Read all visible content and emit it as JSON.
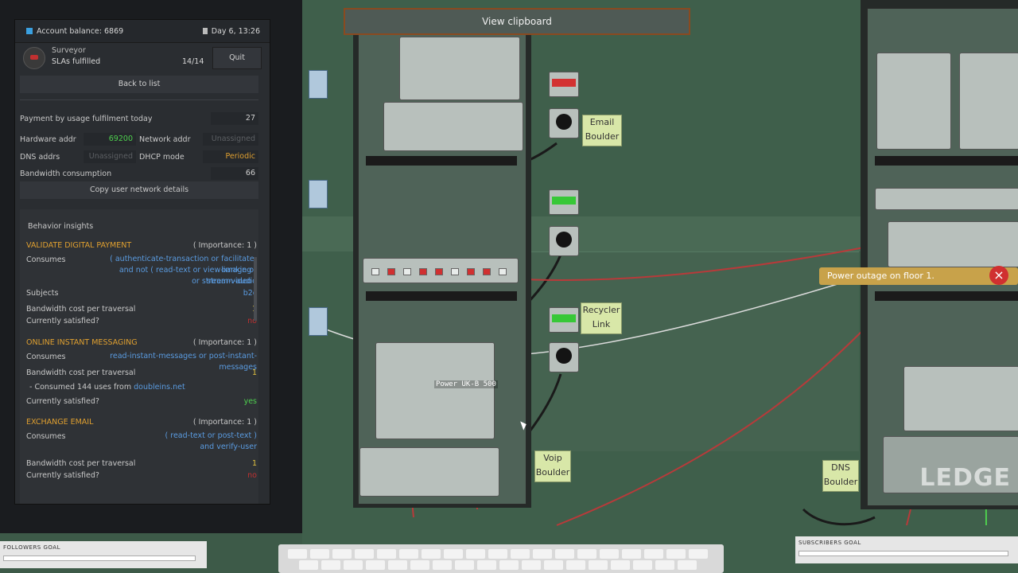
{
  "account": {
    "balance": "Account balance: 6869",
    "day": "Day 6, 13:26"
  },
  "user": {
    "name": "Surveyor",
    "sla": "SLAs fulfilled",
    "count": "14/14",
    "quit": "Quit"
  },
  "back": "Back to list",
  "details": {
    "payment_label": "Payment by usage fulfilment today",
    "payment_val": "27",
    "hw_label": "Hardware addr",
    "hw_val": "69200",
    "net_label": "Network addr",
    "net_val": "Unassigned",
    "dns_label": "DNS addrs",
    "dns_val": "Unassigned",
    "dhcp_label": "DHCP mode",
    "dhcp_val": "Periodic",
    "bw_label": "Bandwidth consumption",
    "bw_val": "66",
    "copy": "Copy user network details"
  },
  "insights": {
    "title": "Behavior insights",
    "items": [
      {
        "name": "VALIDATE DIGITAL PAYMENT",
        "importance": "( Importance: 1 )",
        "consumes_label": "Consumes",
        "consumes_1": "( authenticate-transaction or facilitate-banking )",
        "consumes_2": "and not ( read-text or view-image or stream-audio",
        "consumes_3": "or stream-video )",
        "subjects_label": "Subjects",
        "subjects_val": "b2c",
        "cost_label": "Bandwidth cost per traversal",
        "cost_val": "1",
        "sat_label": "Currently satisfied?",
        "sat_val": "no"
      },
      {
        "name": "ONLINE INSTANT MESSAGING",
        "importance": "( Importance: 1 )",
        "consumes_label": "Consumes",
        "consumes_1": "read-instant-messages or post-instant-messages",
        "cost_label": "Bandwidth cost per traversal",
        "cost_val": "1",
        "note_prefix": "- Consumed 144 uses from ",
        "note_link": "doubleins.net",
        "sat_label": "Currently satisfied?",
        "sat_val": "yes"
      },
      {
        "name": "EXCHANGE EMAIL",
        "importance": "( Importance: 1 )",
        "consumes_label": "Consumes",
        "consumes_1": "( read-text or post-text )",
        "consumes_2": "and verify-user",
        "cost_label": "Bandwidth cost per traversal",
        "cost_val": "1",
        "sat_label": "Currently satisfied?",
        "sat_val": "no"
      }
    ]
  },
  "game": {
    "clipboard": "View clipboard",
    "tags": {
      "email": [
        "Email",
        "Boulder"
      ],
      "recycler": [
        "Recycler",
        "Link"
      ],
      "voip": [
        "Voip",
        "Boulder"
      ],
      "dns": [
        "DNS",
        "Boulder"
      ]
    },
    "power_label": "Power UK-B 500",
    "outage": "Power outage on floor 1.",
    "close_icon": "×",
    "ledge": "LEDGE"
  },
  "overlay": {
    "followers": "FOLLOWERS GOAL",
    "subscribers": "SUBSCRIBERS GOAL"
  },
  "colors": {
    "accent_orange": "#e0a030",
    "link_blue": "#5a9be0",
    "ok_green": "#4ecf4e",
    "bad_red": "#c03030",
    "rack_green": "#3d5a48"
  }
}
